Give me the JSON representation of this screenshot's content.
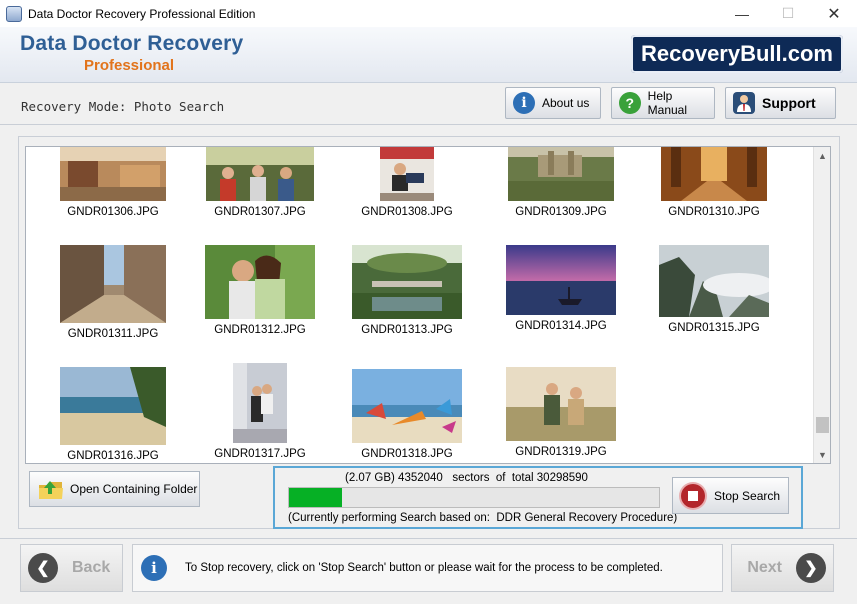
{
  "window": {
    "title": "Data Doctor Recovery Professional Edition",
    "minimize": "—",
    "maximize": "☐",
    "close": "✕"
  },
  "header": {
    "brand_main": "Data Doctor Recovery",
    "brand_sub": "Professional",
    "logo_text": "RecoveryBull.com"
  },
  "mode": {
    "label": "Recovery Mode: Photo Search"
  },
  "buttons": {
    "about": "About us",
    "help": "Help Manual",
    "support": "Support",
    "open_folder": "Open Containing Folder",
    "stop": "Stop Search",
    "back": "Back",
    "next": "Next"
  },
  "gallery": {
    "files": [
      "GNDR01306.JPG",
      "GNDR01307.JPG",
      "GNDR01308.JPG",
      "GNDR01309.JPG",
      "GNDR01310.JPG",
      "GNDR01311.JPG",
      "GNDR01312.JPG",
      "GNDR01313.JPG",
      "GNDR01314.JPG",
      "GNDR01315.JPG",
      "GNDR01316.JPG",
      "GNDR01317.JPG",
      "GNDR01318.JPG",
      "GNDR01319.JPG"
    ],
    "scroll_position": 0.95
  },
  "progress": {
    "status_line": "(2.07 GB) 4352040   sectors  of  total 30298590",
    "sectors_done": 4352040,
    "sectors_total": 30298590,
    "fraction": 0.144,
    "procedure_line": "(Currently performing Search based on:  DDR General Recovery Procedure)"
  },
  "footer": {
    "info_text": "To Stop recovery, click on 'Stop Search' button or please wait for the process to be completed."
  },
  "colors": {
    "brand_blue": "#2f5f95",
    "brand_orange": "#e2741c",
    "progress_green": "#06b025",
    "highlight_border": "#5aa7d6"
  }
}
